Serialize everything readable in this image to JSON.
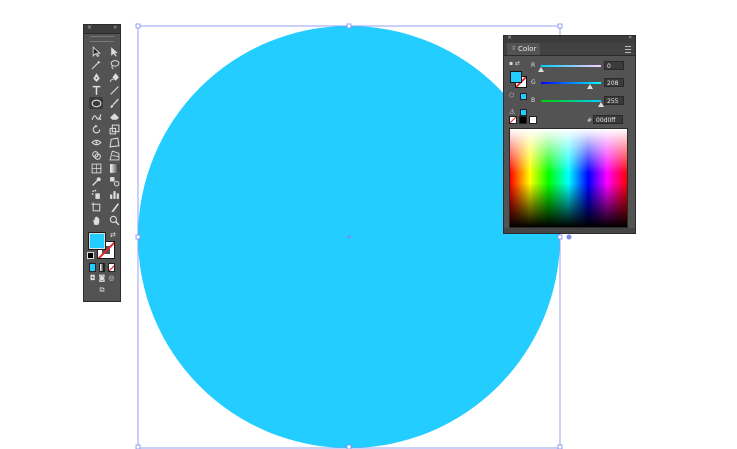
{
  "document": {
    "fill_color": "#24cdff",
    "selection_color": "#7b8cf0"
  },
  "tools_panel": {
    "close_glyph": "×",
    "collapse_glyph": "«",
    "fill_swatch_color": "#24cdff",
    "stroke_swatch": "none",
    "tools": [
      "selection-tool",
      "direct-selection-tool",
      "magic-wand-tool",
      "lasso-tool",
      "pen-tool",
      "curvature-tool",
      "type-tool",
      "line-segment-tool",
      "ellipse-tool",
      "paintbrush-tool",
      "shaper-tool",
      "eraser-tool",
      "rotate-tool",
      "scale-tool",
      "width-tool",
      "free-transform-tool",
      "shape-builder-tool",
      "perspective-grid-tool",
      "mesh-tool",
      "gradient-tool",
      "eyedropper-tool",
      "blend-tool",
      "symbol-sprayer-tool",
      "column-graph-tool",
      "artboard-tool",
      "slice-tool",
      "hand-tool",
      "zoom-tool"
    ]
  },
  "color_panel": {
    "title": "Color",
    "close_glyph": "×",
    "collapse_glyph": "«",
    "fill_color": "#24cdff",
    "sliders": [
      {
        "label": "R",
        "value": "0",
        "fraction": 0.0,
        "gradient": "linear-gradient(to right,#00cdff,#ffcdff)"
      },
      {
        "label": "G",
        "value": "208",
        "fraction": 0.816,
        "gradient": "linear-gradient(to right,#0000ff,#00ffff)"
      },
      {
        "label": "B",
        "value": "255",
        "fraction": 1.0,
        "gradient": "linear-gradient(to right,#00cd00,#00cdff)"
      }
    ],
    "hex_label": "#",
    "hex_value": "00d0ff"
  }
}
